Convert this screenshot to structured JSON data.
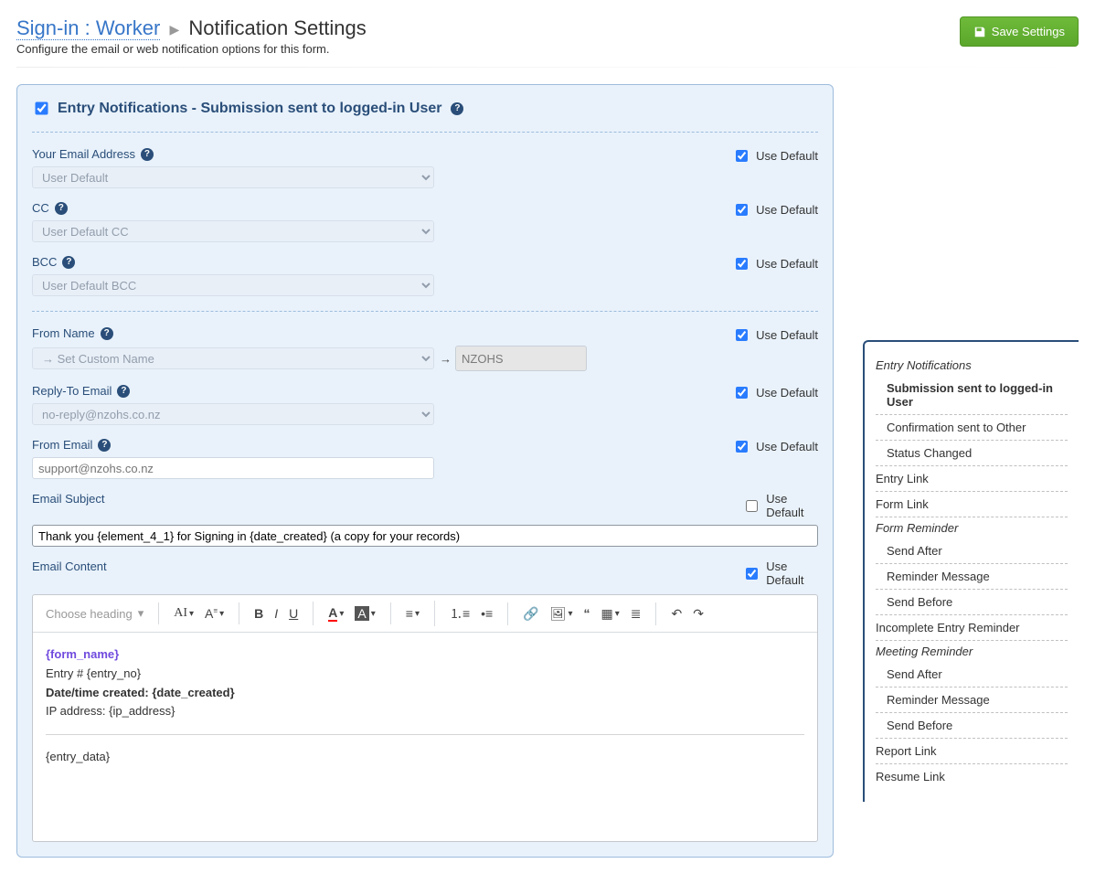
{
  "header": {
    "breadcrumb_link": "Sign-in : Worker",
    "page_title_tail": "Notification Settings",
    "subtitle": "Configure the email or web notification options for this form.",
    "save_label": "Save Settings"
  },
  "panel": {
    "title": "Entry Notifications - Submission sent to logged-in User",
    "checked": true
  },
  "use_default_label": "Use Default",
  "fields": {
    "email_address": {
      "label": "Your Email Address",
      "value": "User Default",
      "use_default": true
    },
    "cc": {
      "label": "CC",
      "value": "User Default CC",
      "use_default": true
    },
    "bcc": {
      "label": "BCC",
      "value": "User Default BCC",
      "use_default": true
    },
    "from_name": {
      "label": "From Name",
      "value": "→ Set Custom Name",
      "extra_arrow": "→",
      "extra_value": "NZOHS",
      "use_default": true
    },
    "reply_to": {
      "label": "Reply-To Email",
      "value": "no-reply@nzohs.co.nz",
      "use_default": true
    },
    "from_email": {
      "label": "From Email",
      "placeholder": "support@nzohs.co.nz",
      "use_default": true
    },
    "subject": {
      "label": "Email Subject",
      "value": "Thank you {element_4_1} for Signing in {date_created} (a copy for your records)",
      "use_default": false
    },
    "content": {
      "label": "Email Content",
      "use_default": true
    }
  },
  "editor": {
    "heading_label": "Choose heading",
    "body": {
      "form_name": "{form_name}",
      "entry_line_prefix": "Entry # ",
      "entry_line_token": "{entry_no}",
      "date_prefix": "Date/time created: ",
      "date_token": "{date_created}",
      "ip_prefix": "IP address: ",
      "ip_token": "{ip_address}",
      "entry_data": "{entry_data}"
    }
  },
  "sidebar": {
    "sec1_label": "Entry Notifications",
    "items1": [
      "Submission sent to logged-in User",
      "Confirmation sent to Other",
      "Status Changed"
    ],
    "items2": [
      "Entry Link",
      "Form Link"
    ],
    "sec3_label": "Form Reminder",
    "items3": [
      "Send After",
      "Reminder Message",
      "Send Before"
    ],
    "items4": [
      "Incomplete Entry Reminder"
    ],
    "sec5_label": "Meeting Reminder",
    "items5": [
      "Send After",
      "Reminder Message",
      "Send Before"
    ],
    "items6": [
      "Report Link",
      "Resume Link"
    ]
  }
}
